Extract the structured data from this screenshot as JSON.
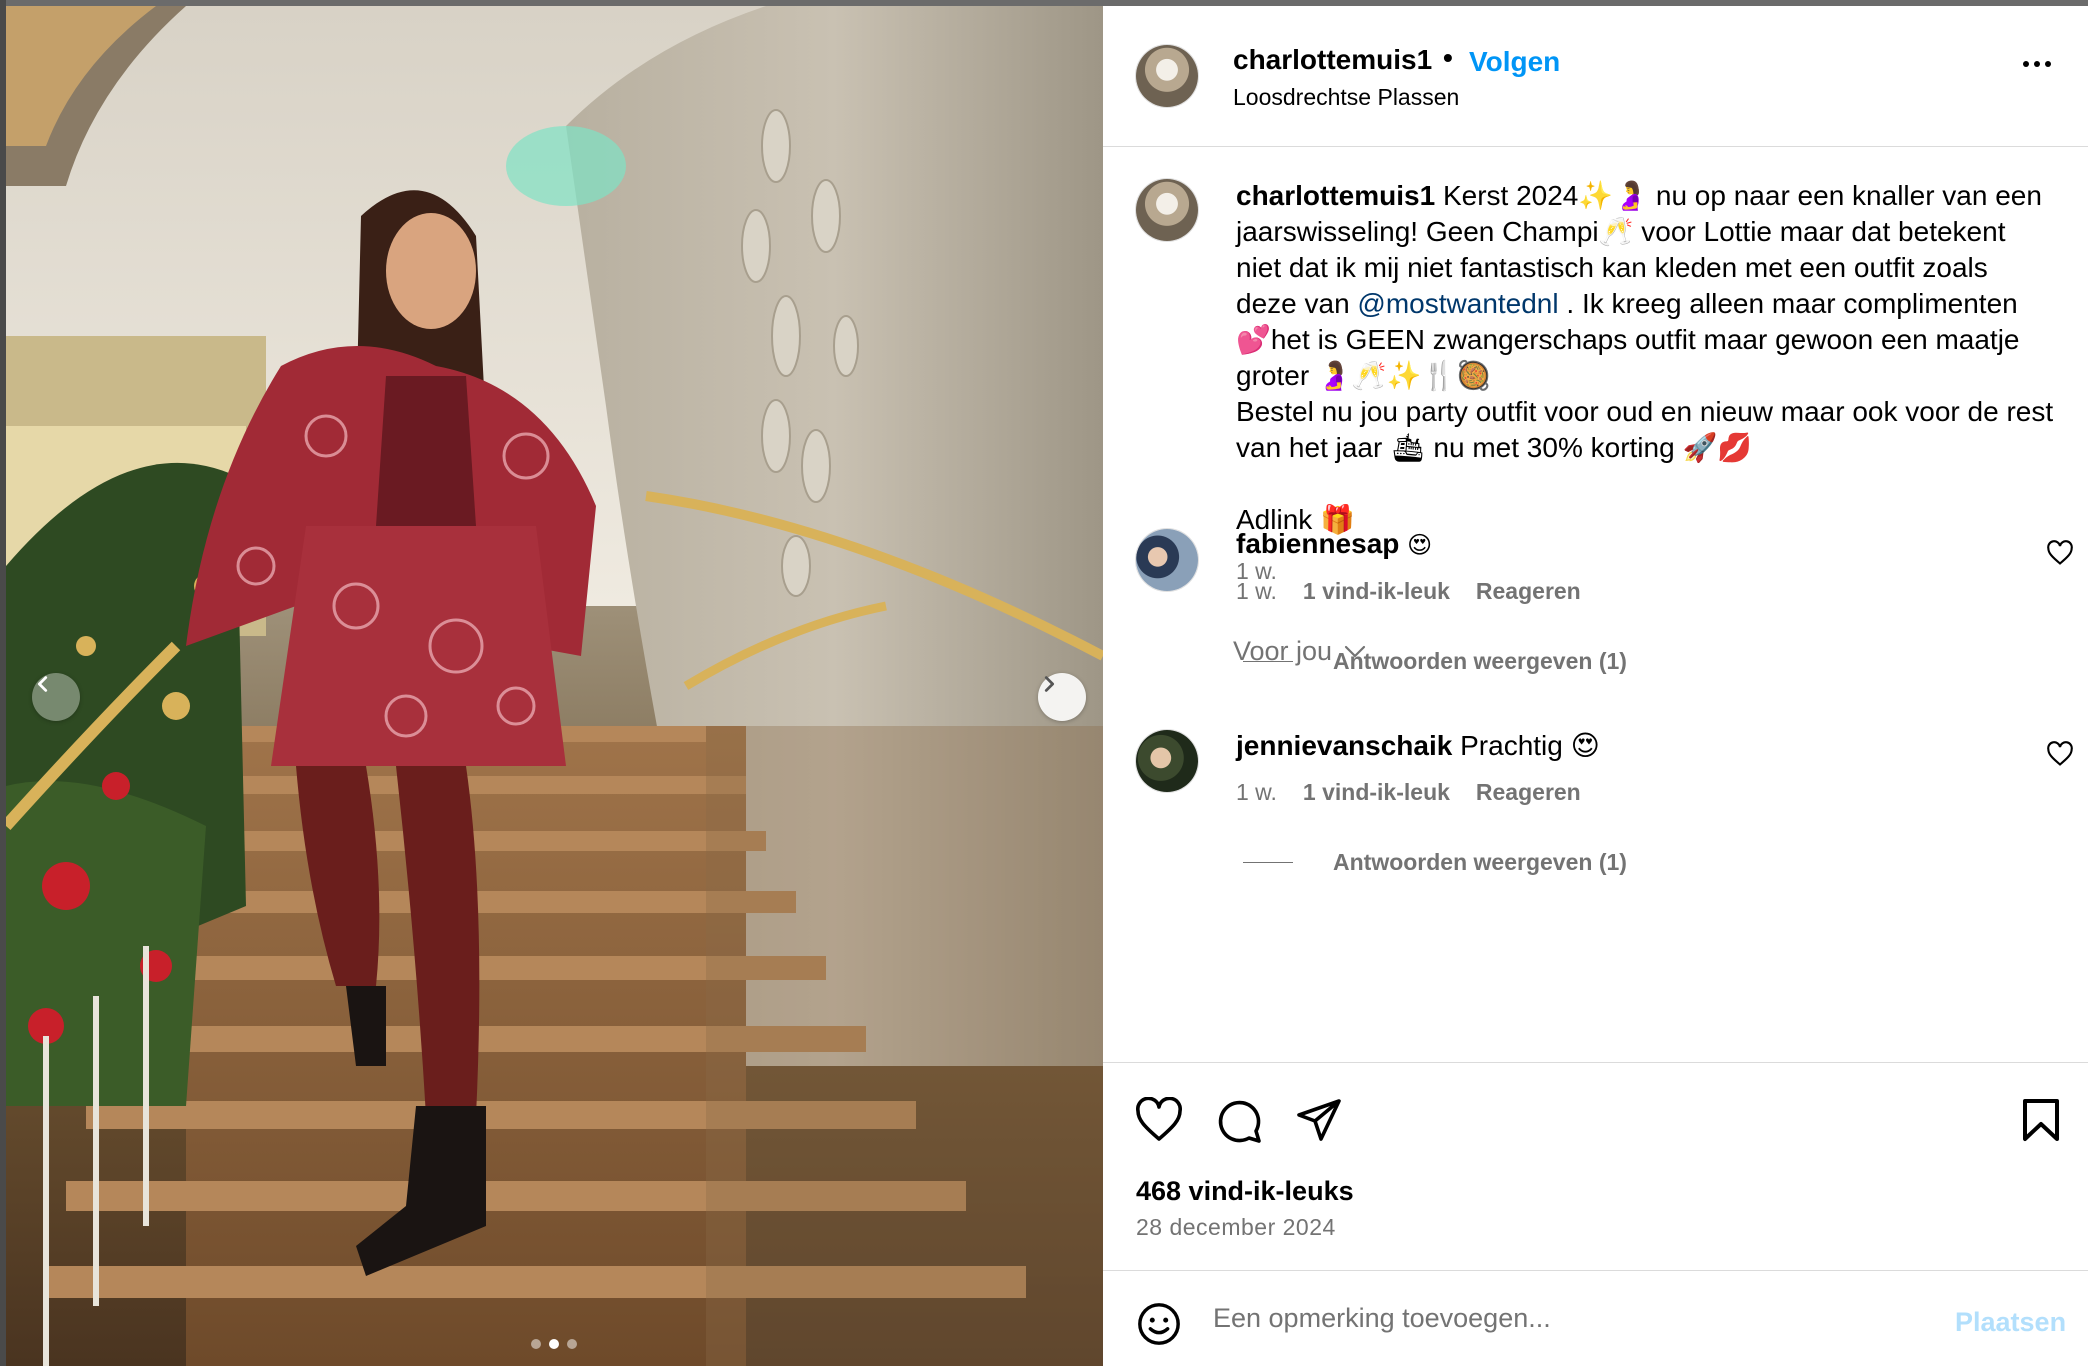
{
  "post": {
    "username": "charlottemuis1",
    "separator": "•",
    "follow_label": "Volgen",
    "location": "Loosdrechtse Plassen",
    "caption_text": "Kerst 2024✨🤰 nu op naar een knaller van een jaarswisseling! Geen Champi🥂 voor Lottie maar dat betekent niet dat ik mij niet fantastisch kan kleden met een outfit zoals deze van",
    "mention": "@mostwantednl",
    "caption_text_2": ". Ik kreeg alleen maar complimenten 💕het is GEEN zwangerschaps outfit maar gewoon een maatje groter 🤰🥂✨🍴🥘",
    "caption_text_3": "Bestel nu jou party outfit voor oud en nieuw maar ook voor de rest van het jaar 🛳 nu met 30% korting 🚀💋",
    "caption_text_4": "Adlink 🎁",
    "caption_time": "1 w.",
    "for_you_label": "Voor jou",
    "likes": "468 vind-ik-leuks",
    "date": "28 december 2024",
    "comment_placeholder": "Een opmerking toevoegen...",
    "post_label": "Plaatsen"
  },
  "comments": [
    {
      "username": "fabiennesap",
      "text": "😍",
      "time": "1 w.",
      "likes": "1 vind-ik-leuk",
      "reply_label": "Reageren",
      "view_replies": "Antwoorden weergeven (1)"
    },
    {
      "username": "jennievanschaik",
      "text": "Prachtig 😍",
      "time": "1 w.",
      "likes": "1 vind-ik-leuk",
      "reply_label": "Reageren",
      "view_replies": "Antwoorden weergeven (1)"
    }
  ],
  "carousel": {
    "total_slides": 3,
    "active_slide": 2
  },
  "icons": {
    "like": "heart-icon",
    "comment": "comment-bubble-icon",
    "share": "paper-plane-icon",
    "save": "bookmark-icon",
    "more": "more-options-icon",
    "emoji": "smiley-icon",
    "prev": "chevron-left-icon",
    "next": "chevron-right-icon"
  },
  "colors": {
    "follow_blue": "#0095f6",
    "mention_blue": "#00376b",
    "secondary_text": "#737373",
    "post_disabled": "#b2dffc",
    "divider": "#dbdbdb"
  }
}
